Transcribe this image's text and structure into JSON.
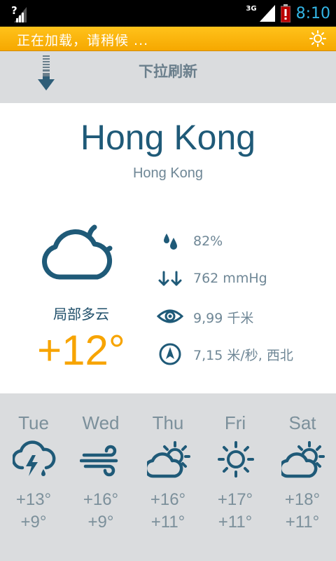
{
  "status_bar": {
    "network": "3G",
    "time": "8:10"
  },
  "loading": {
    "text": "正在加载，请稍候 ..."
  },
  "pull_refresh": {
    "text": "下拉刷新"
  },
  "location": {
    "city": "Hong Kong",
    "region": "Hong Kong"
  },
  "current": {
    "condition": "局部多云",
    "temperature": "+12°",
    "icon": "partly-cloudy-night-icon",
    "humidity": "82%",
    "pressure": "762 mmHg",
    "visibility": "9,99 千米",
    "wind": "7,15 米/秒, 西北"
  },
  "forecast": [
    {
      "day": "Tue",
      "high": "+13°",
      "low": "+9°",
      "icon": "thunderstorm-icon"
    },
    {
      "day": "Wed",
      "high": "+16°",
      "low": "+9°",
      "icon": "wind-icon"
    },
    {
      "day": "Thu",
      "high": "+16°",
      "low": "+11°",
      "icon": "partly-cloudy-icon"
    },
    {
      "day": "Fri",
      "high": "+17°",
      "low": "+11°",
      "icon": "sunny-icon"
    },
    {
      "day": "Sat",
      "high": "+18°",
      "low": "+11°",
      "icon": "partly-cloudy-icon"
    }
  ],
  "colors": {
    "accent_orange": "#f7a400",
    "city_blue": "#1f5a78",
    "status_time": "#33b5e5",
    "background_gray": "#dadcde"
  }
}
